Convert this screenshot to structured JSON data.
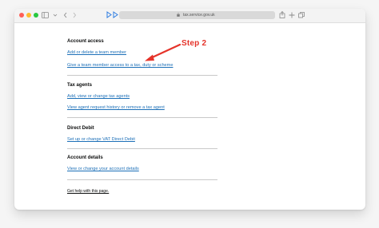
{
  "browser": {
    "url": "tax.service.gov.uk",
    "colors": {
      "close": "#ff5f57",
      "minimize": "#febc2e",
      "zoom": "#28c840"
    }
  },
  "sections": [
    {
      "heading": "Account access",
      "links": [
        "Add or delete a team member",
        "Give a team member access to a tax, duty or scheme"
      ]
    },
    {
      "heading": "Tax agents",
      "links": [
        "Add, view or change tax agents",
        "View agent request history or remove a tax agent"
      ]
    },
    {
      "heading": "Direct Debit",
      "links": [
        "Set up or change VAT Direct Debit"
      ]
    },
    {
      "heading": "Account details",
      "links": [
        "View or change your account details"
      ]
    }
  ],
  "help_link": "Get help with this page.",
  "annotation": {
    "label": "Step 2",
    "color": "#e5332a"
  },
  "link_color": "#1d70b8"
}
